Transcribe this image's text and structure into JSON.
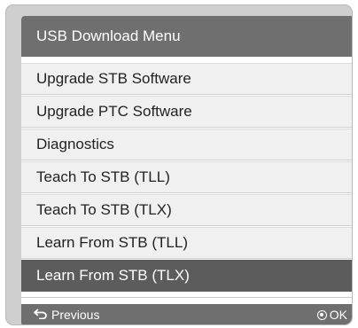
{
  "window": {
    "title": "USB Download Menu"
  },
  "menu": {
    "items": [
      {
        "label": "Upgrade STB Software",
        "selected": false
      },
      {
        "label": "Upgrade PTC Software",
        "selected": false
      },
      {
        "label": "Diagnostics",
        "selected": false
      },
      {
        "label": "Teach To STB (TLL)",
        "selected": false
      },
      {
        "label": "Teach To STB (TLX)",
        "selected": false
      },
      {
        "label": "Learn From STB (TLL)",
        "selected": false
      },
      {
        "label": "Learn From STB (TLX)",
        "selected": true
      }
    ]
  },
  "footer": {
    "previous_label": "Previous",
    "previous_icon": "back-arrow-icon",
    "ok_label": "OK",
    "ok_icon": "ok-circle-icon"
  },
  "colors": {
    "title_bar": "#6f6f6f",
    "selected_item": "#5c5c5c",
    "item_background": "#f0f0f0",
    "frame": "#cfcfcf"
  }
}
